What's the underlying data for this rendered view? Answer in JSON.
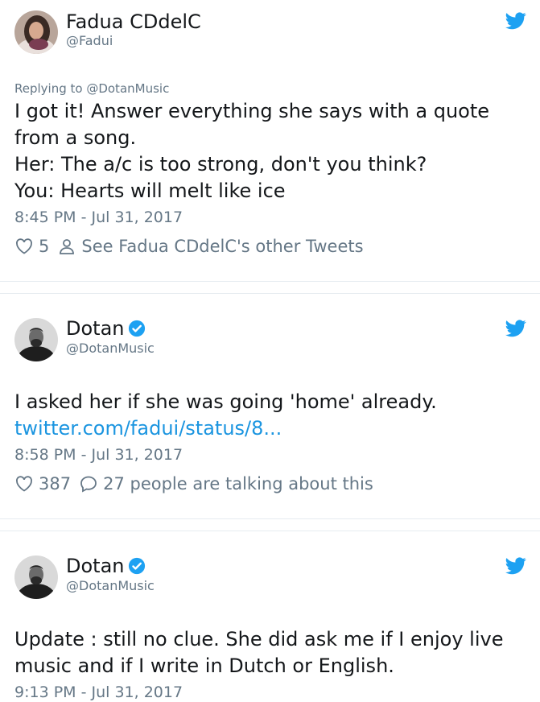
{
  "tweets": [
    {
      "name": "Fadua CDdelC",
      "handle": "@Fadui",
      "replying_to": "Replying to @DotanMusic",
      "text": "I got it! Answer everything she says with a quote\nfrom a song.\nHer: The a/c is too strong, don't you think?\nYou: Hearts will melt like ice",
      "time": "8:45 PM - Jul 31, 2017",
      "likes": "5",
      "action_text": "See Fadua CDdelC's other Tweets"
    },
    {
      "name": "Dotan",
      "handle": "@DotanMusic",
      "text": "I asked her if she was going 'home' already.",
      "link": "twitter.com/fadui/status/8...",
      "time": "8:58 PM - Jul 31, 2017",
      "likes": "387",
      "action_text": "27 people are talking about this"
    },
    {
      "name": "Dotan",
      "handle": "@DotanMusic",
      "text": "Update : still no clue. She did ask me if I enjoy live\nmusic and if I write in Dutch or English.",
      "time": "9:13 PM - Jul 31, 2017"
    }
  ],
  "colors": {
    "twitter_blue": "#1da1f2",
    "link": "#1b95e0",
    "secondary_text": "#657786",
    "divider": "#e6ecf0"
  }
}
